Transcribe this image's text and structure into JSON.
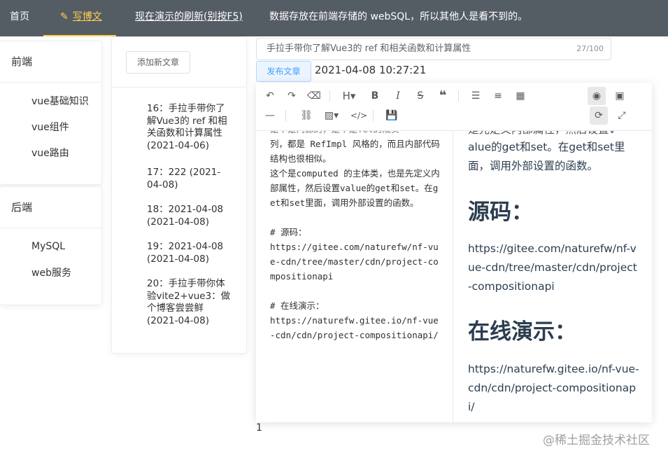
{
  "nav": {
    "home": "首页",
    "write": "写博文",
    "refresh": "现在演示的刷新(别按F5)",
    "notice": "数据存放在前端存储的 webSQL，所以其他人是看不到的。"
  },
  "categories": [
    {
      "group": "前端",
      "items": [
        "vue基础知识",
        "vue组件",
        "vue路由"
      ]
    },
    {
      "group": "后端",
      "items": [
        "MySQL",
        "web服务"
      ]
    }
  ],
  "articles": {
    "add_button": "添加新文章",
    "items": [
      "16：手拉手带你了解Vue3的 ref 和相关函数和计算属性 (2021-04-06)",
      "17：222 (2021-04-08)",
      "18：2021-04-08 (2021-04-08)",
      "19：2021-04-08 (2021-04-08)",
      "20：手拉手带你体验vite2+vue3：做个博客尝尝鲜 (2021-04-08)"
    ]
  },
  "editor_header": {
    "title_value": "手拉手带你了解Vue3的 ref 和相关函数和计算属性",
    "title_count": "27/100",
    "publish_label": "发布文章",
    "datetime": "2021-04-08 10:27:21"
  },
  "source_pane": {
    "partial_top": "是个是内源的，是个是Yel的规实",
    "body": "列，都是 RefImpl 风格的，而且内部代码结构也很相似。\n这个是computed 的主体类，也是先定义内部属性，然后设置value的get和set。在get和set里面，调用外部设置的函数。\n\n# 源码：\nhttps://gitee.com/naturefw/nf-vue-cdn/tree/master/cdn/project-compositionapi\n\n# 在线演示：\nhttps://naturefw.gitee.io/nf-vue-cdn/cdn/project-compositionapi/"
  },
  "preview_pane": {
    "partial_top": "是先定义内部属性，然后设置v",
    "para1": "alue的get和set。在get和set里面，调用外部设置的函数。",
    "h_source": "源码：",
    "source_url": "https://gitee.com/naturefw/nf-vue-cdn/tree/master/cdn/project-compositionapi",
    "h_demo": "在线演示：",
    "demo_url": "https://naturefw.gitee.io/nf-vue-cdn/cdn/project-compositionapi/"
  },
  "page_number": "1",
  "watermark": "@稀土掘金技术社区",
  "colors": {
    "nav_bg": "#545c64",
    "nav_active": "#ffd04b",
    "primary": "#409eff"
  },
  "toolbar_icons": [
    "undo-icon",
    "redo-icon",
    "eraser-icon",
    "heading-icon",
    "bold-icon",
    "italic-icon",
    "strikethrough-icon",
    "quote-icon",
    "unordered-list-icon",
    "ordered-list-icon",
    "table-icon",
    "preview-icon",
    "fullscreen-preview-icon",
    "horizontal-rule-icon",
    "link-icon",
    "image-icon",
    "code-icon",
    "save-icon",
    "sync-scroll-icon",
    "fullscreen-icon"
  ]
}
